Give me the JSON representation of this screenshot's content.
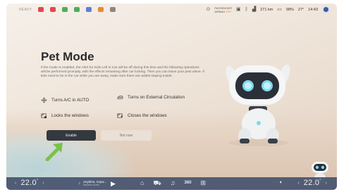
{
  "status": {
    "ready": "READY",
    "airbag_line1": "PASSENGER",
    "airbag_line2": "AIRBAG",
    "airbag_state": "OFF",
    "range": "271 km",
    "battery": "98%",
    "outside_temp": "27°",
    "clock": "14:43"
  },
  "page": {
    "title": "Pet Mode",
    "description": "If the mode is enabled, the Alert for Kids Left in Car will be off during this time and the following operations will be performed promptly, with the effects remaining after car locking. Then you can leave your pets alone. If kids need to be in the car while you are away, make sure there are adults staying inside."
  },
  "features": [
    {
      "icon": "fan-icon",
      "label": "Turns A/C in AUTO"
    },
    {
      "icon": "external-circulation-icon",
      "label": "Turns on External Circulation"
    },
    {
      "icon": "window-lock-icon",
      "label": "Locks the windows"
    },
    {
      "icon": "window-close-icon",
      "label": "Closes the windows"
    }
  ],
  "buttons": {
    "enable": "Enable",
    "not_now": "Not now"
  },
  "dock": {
    "temp_left": "22.0",
    "temp_right": "22.0",
    "temp_unit": "°",
    "song": "Anytime, Anyw...",
    "song_sub": "Random Audio"
  },
  "colors": {
    "primary_button": "#34383f",
    "dock_bg": "#46526e",
    "airbag_off": "#e38b3a",
    "pointer_arrow": "#7cc04a"
  }
}
